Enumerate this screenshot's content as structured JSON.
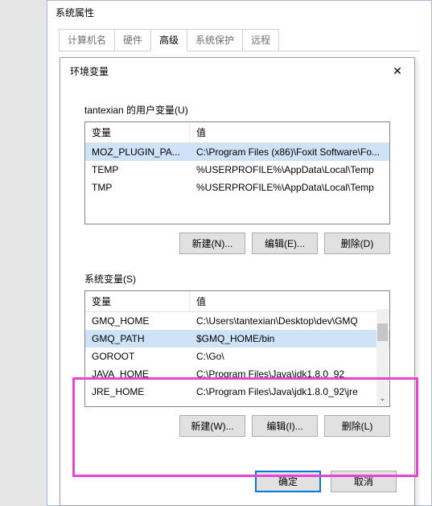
{
  "parent": {
    "title": "系统属性",
    "tabs": [
      "计算机名",
      "硬件",
      "高级",
      "系统保护",
      "远程"
    ],
    "active_tab_index": 2
  },
  "child": {
    "title": "环境变量",
    "close_label": "✕"
  },
  "user_section": {
    "label": "tantexian 的用户变量(U)",
    "col_var": "变量",
    "col_val": "值",
    "rows": [
      {
        "var": "MOZ_PLUGIN_PA...",
        "val": "C:\\Program Files (x86)\\Foxit Software\\Fo..."
      },
      {
        "var": "TEMP",
        "val": "%USERPROFILE%\\AppData\\Local\\Temp"
      },
      {
        "var": "TMP",
        "val": "%USERPROFILE%\\AppData\\Local\\Temp"
      }
    ],
    "selected_index": 0,
    "btn_new": "新建(N)...",
    "btn_edit": "编辑(E)...",
    "btn_delete": "删除(D)"
  },
  "sys_section": {
    "label": "系统变量(S)",
    "col_var": "变量",
    "col_val": "值",
    "rows": [
      {
        "var": "GMQ_HOME",
        "val": "C:\\Users\\tantexian\\Desktop\\dev\\GMQ"
      },
      {
        "var": "GMQ_PATH",
        "val": "$GMQ_HOME/bin"
      },
      {
        "var": "GOROOT",
        "val": "C:\\Go\\"
      },
      {
        "var": "JAVA_HOME",
        "val": "C:\\Program Files\\Java\\jdk1.8.0_92"
      },
      {
        "var": "JRE_HOME",
        "val": "C:\\Program Files\\Java\\jdk1.8.0_92\\jre"
      }
    ],
    "selected_index": 1,
    "btn_new": "新建(W)...",
    "btn_edit": "编辑(I)...",
    "btn_delete": "删除(L)"
  },
  "footer": {
    "ok": "确定",
    "cancel": "取消"
  }
}
